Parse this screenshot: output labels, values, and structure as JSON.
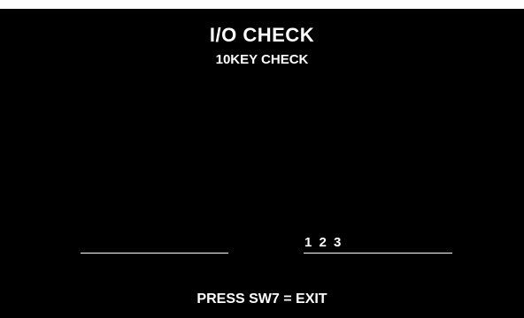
{
  "screen": {
    "title": "I/O CHECK",
    "subtitle": "10KEY CHECK",
    "left_input_value": "",
    "right_input_value": "1 2 3",
    "footer": "PRESS SW7 = EXIT",
    "colors": {
      "background": "#000000",
      "text": "#ffffff"
    }
  }
}
